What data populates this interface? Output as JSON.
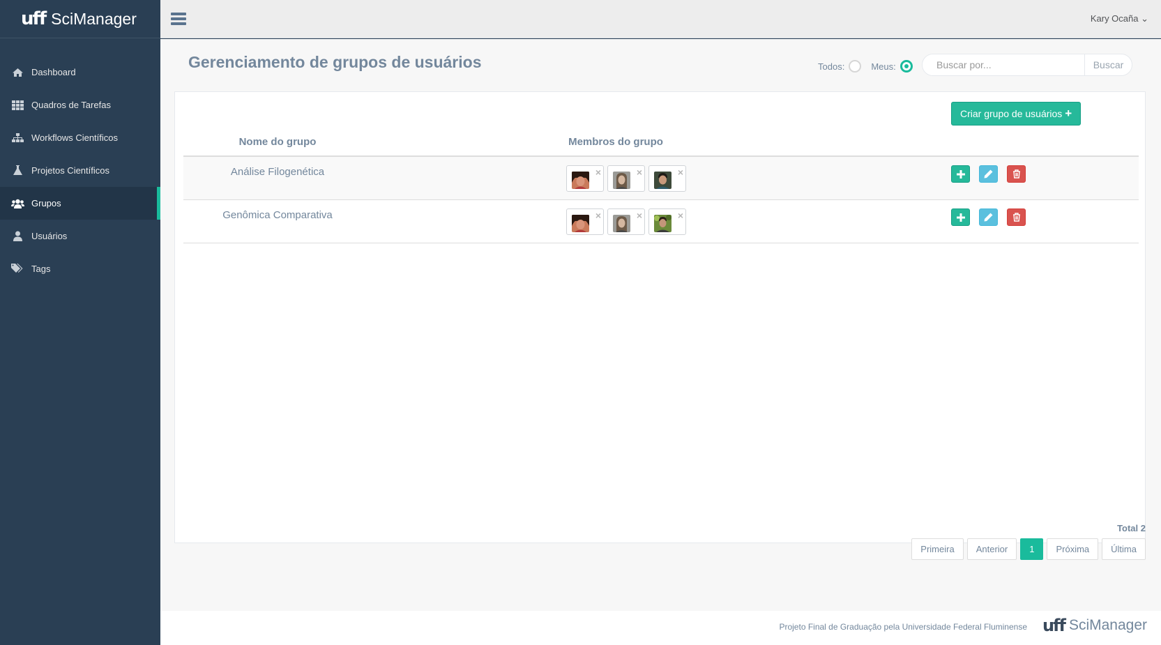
{
  "brand": {
    "logo": "uff",
    "name": "SciManager"
  },
  "sidebar": {
    "items": [
      {
        "label": "Dashboard",
        "icon": "home-icon"
      },
      {
        "label": "Quadros de Tarefas",
        "icon": "grid-icon"
      },
      {
        "label": "Workflows Científicos",
        "icon": "sitemap-icon"
      },
      {
        "label": "Projetos Científicos",
        "icon": "flask-icon"
      },
      {
        "label": "Grupos",
        "icon": "users-icon",
        "active": true
      },
      {
        "label": "Usuários",
        "icon": "user-icon"
      },
      {
        "label": "Tags",
        "icon": "tags-icon"
      }
    ]
  },
  "topbar": {
    "user": "Kary Ocaña ⌄"
  },
  "page": {
    "title": "Gerenciamento de grupos de usuários",
    "filter_all": "Todos:",
    "filter_mine": "Meus:",
    "selected_filter": "Meus",
    "search_placeholder": "Buscar por...",
    "search_button": "Buscar",
    "create_button": "Criar grupo de usuários"
  },
  "table": {
    "headers": [
      "Nome do grupo",
      "Membros do grupo"
    ],
    "rows": [
      {
        "name": "Análise Filogenética",
        "member_count": 3
      },
      {
        "name": "Genômica Comparativa",
        "member_count": 3
      }
    ]
  },
  "pagination": {
    "total": "Total 2",
    "first": "Primeira",
    "prev": "Anterior",
    "current": "1",
    "next": "Próxima",
    "last": "Última"
  },
  "footer": {
    "text": "Projeto Final de Graduação pela Universidade Federal Fluminense",
    "logo": "uff",
    "name": "SciManager"
  },
  "colors": {
    "accent": "#1abb9c",
    "sidebar": "#2a3f54",
    "danger": "#d9534f",
    "info": "#5bc0de"
  }
}
